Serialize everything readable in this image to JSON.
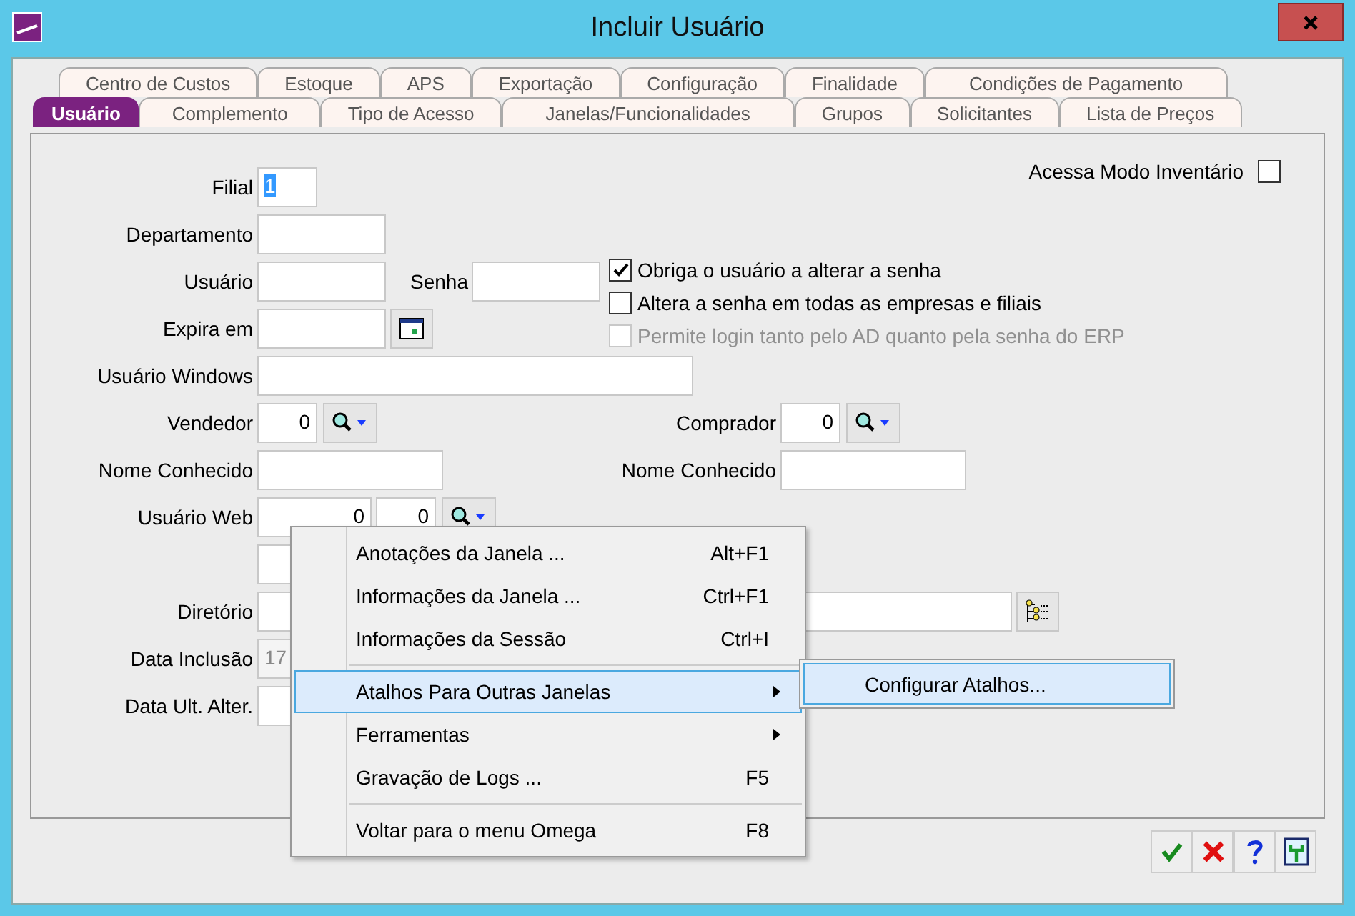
{
  "window": {
    "title": "Incluir Usuário"
  },
  "tab_rows": [
    [
      {
        "label": "Centro de Custos",
        "selected": false
      },
      {
        "label": "Estoque",
        "selected": false
      },
      {
        "label": "APS",
        "selected": false
      },
      {
        "label": "Exportação",
        "selected": false
      },
      {
        "label": "Configuração",
        "selected": false
      },
      {
        "label": "Finalidade",
        "selected": false
      },
      {
        "label": "Condições de Pagamento",
        "selected": false
      }
    ],
    [
      {
        "label": "Usuário",
        "selected": true
      },
      {
        "label": "Complemento",
        "selected": false
      },
      {
        "label": "Tipo de Acesso",
        "selected": false
      },
      {
        "label": "Janelas/Funcionalidades",
        "selected": false
      },
      {
        "label": "Grupos",
        "selected": false
      },
      {
        "label": "Solicitantes",
        "selected": false
      },
      {
        "label": "Lista de Preços",
        "selected": false
      }
    ]
  ],
  "form": {
    "filial": {
      "label": "Filial",
      "value": "1"
    },
    "departamento": {
      "label": "Departamento"
    },
    "usuario": {
      "label": "Usuário"
    },
    "senha": {
      "label": "Senha"
    },
    "expira_em": {
      "label": "Expira em"
    },
    "usuario_windows": {
      "label": "Usuário Windows"
    },
    "vendedor": {
      "label": "Vendedor",
      "value": "0"
    },
    "nome_conhecido_vendedor": {
      "label": "Nome Conhecido"
    },
    "usuario_web": {
      "label": "Usuário Web",
      "value": "0",
      "value_2": "0"
    },
    "diretorio": {
      "label": "Diretório"
    },
    "data_inclusao": {
      "label": "Data Inclusão",
      "value": "17"
    },
    "data_ult_alter": {
      "label": "Data Ult. Alter."
    },
    "comprador": {
      "label": "Comprador",
      "value": "0"
    },
    "nome_conhecido_comprador": {
      "label": "Nome Conhecido"
    },
    "acessa_modo_inventario": {
      "label": "Acessa Modo Inventário",
      "checked": false
    }
  },
  "checkboxes": [
    {
      "label": "Obriga o usuário a alterar a senha",
      "checked": true,
      "disabled": false
    },
    {
      "label": "Altera a senha em todas as empresas e filiais",
      "checked": false,
      "disabled": false
    },
    {
      "label": "Permite login tanto pelo AD quanto pela senha do ERP",
      "checked": false,
      "disabled": true
    }
  ],
  "context_menu": [
    {
      "label": "Anotações da Janela ...",
      "shortcut": "Alt+F1",
      "submenu": false,
      "selected": false,
      "separator_before": false
    },
    {
      "label": "Informações da Janela ...",
      "shortcut": "Ctrl+F1",
      "submenu": false,
      "selected": false,
      "separator_before": false
    },
    {
      "label": "Informações da Sessão",
      "shortcut": "Ctrl+I",
      "submenu": false,
      "selected": false,
      "separator_before": false
    },
    {
      "label": "Atalhos Para Outras Janelas",
      "submenu": true,
      "selected": true,
      "separator_before": true
    },
    {
      "label": "Ferramentas",
      "submenu": true,
      "selected": false,
      "separator_before": false
    },
    {
      "label": "Gravação de Logs ...",
      "shortcut": "F5",
      "submenu": false,
      "selected": false,
      "separator_before": false
    },
    {
      "label": "Voltar para o menu Omega",
      "shortcut": "F8",
      "submenu": false,
      "selected": false,
      "separator_before": true
    }
  ],
  "submenu": [
    {
      "label": "Configurar Atalhos...",
      "selected": true
    }
  ]
}
